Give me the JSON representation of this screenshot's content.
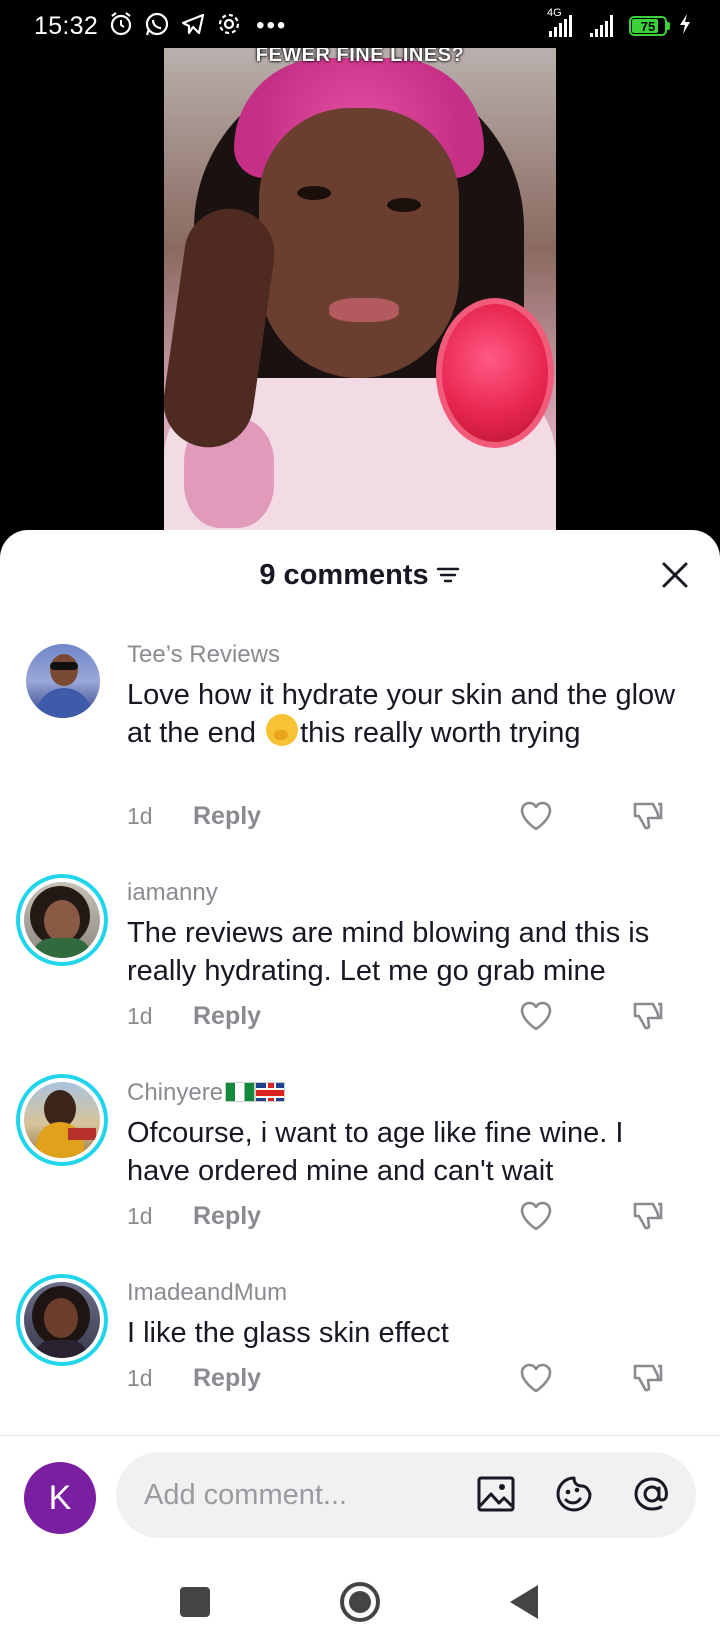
{
  "status_bar": {
    "time": "15:32",
    "network_type": "4G",
    "battery_level": "75",
    "battery_percent": 75
  },
  "video": {
    "caption": "FEWER FINE LINES?"
  },
  "comments_sheet": {
    "title": "9 comments",
    "comments": [
      {
        "username": "Tee’s Reviews",
        "text_before_emoji": "Love how it hydrate your skin and the glow at the end ",
        "emoji_icon": "face-with-hand-over-mouth-emoji",
        "text_after_emoji": "this really worth trying",
        "time": "1d",
        "reply_label": "Reply"
      },
      {
        "username": "iamanny",
        "text": "The reviews are mind blowing and this is really hydrating. Let me go grab mine",
        "time": "1d",
        "reply_label": "Reply"
      },
      {
        "username": "Chinyere",
        "flags": [
          "nigeria-flag-icon",
          "uk-flag-icon"
        ],
        "text": "Ofcourse, i want to age like fine wine. I have ordered mine and can't wait",
        "time": "1d",
        "reply_label": "Reply"
      },
      {
        "username": "ImadeandMum",
        "text": "I like the glass skin effect",
        "time": "1d",
        "reply_label": "Reply"
      }
    ]
  },
  "composer": {
    "avatar_letter": "K",
    "placeholder": "Add comment..."
  },
  "colors": {
    "ring": "#20d5ec",
    "avatar_purple": "#7b1fa2",
    "text_primary": "#161823",
    "text_secondary": "#8a8b91",
    "battery_green": "#3cd23c"
  }
}
